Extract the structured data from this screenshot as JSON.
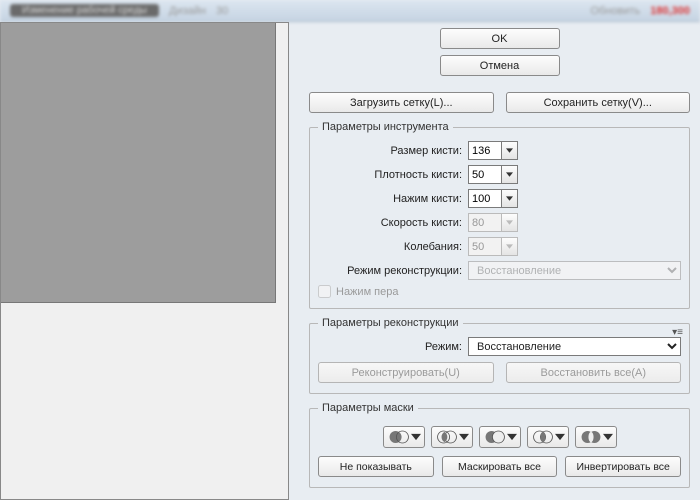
{
  "titlebar": {
    "blurred_text_1": "Изменение рабочей среды",
    "blurred_text_2": "Дизайн",
    "blurred_text_3": "30",
    "blurred_text_4": "Обновить",
    "blurred_text_5": "180,300"
  },
  "top": {
    "ok": "OK",
    "cancel": "Отмена"
  },
  "mesh": {
    "load": "Загрузить сетку(L)...",
    "save": "Сохранить сетку(V)..."
  },
  "tool_params": {
    "legend": "Параметры инструмента",
    "brush_size_label": "Размер кисти:",
    "brush_size_value": "136",
    "brush_density_label": "Плотность кисти:",
    "brush_density_value": "50",
    "brush_pressure_label": "Нажим кисти:",
    "brush_pressure_value": "100",
    "brush_rate_label": "Скорость кисти:",
    "brush_rate_value": "80",
    "turbulence_label": "Колебания:",
    "turbulence_value": "50",
    "recon_mode_label": "Режим реконструкции:",
    "recon_mode_value": "Восстановление",
    "pen_pressure": "Нажим пера"
  },
  "recon_params": {
    "legend": "Параметры реконструкции",
    "mode_label": "Режим:",
    "mode_value": "Восстановление",
    "reconstruct_btn": "Реконструировать(U)",
    "restore_all_btn": "Восстановить все(A)"
  },
  "mask_params": {
    "legend": "Параметры маски",
    "no_show": "Не показывать",
    "mask_all": "Маскировать все",
    "invert_all": "Инвертировать все"
  }
}
